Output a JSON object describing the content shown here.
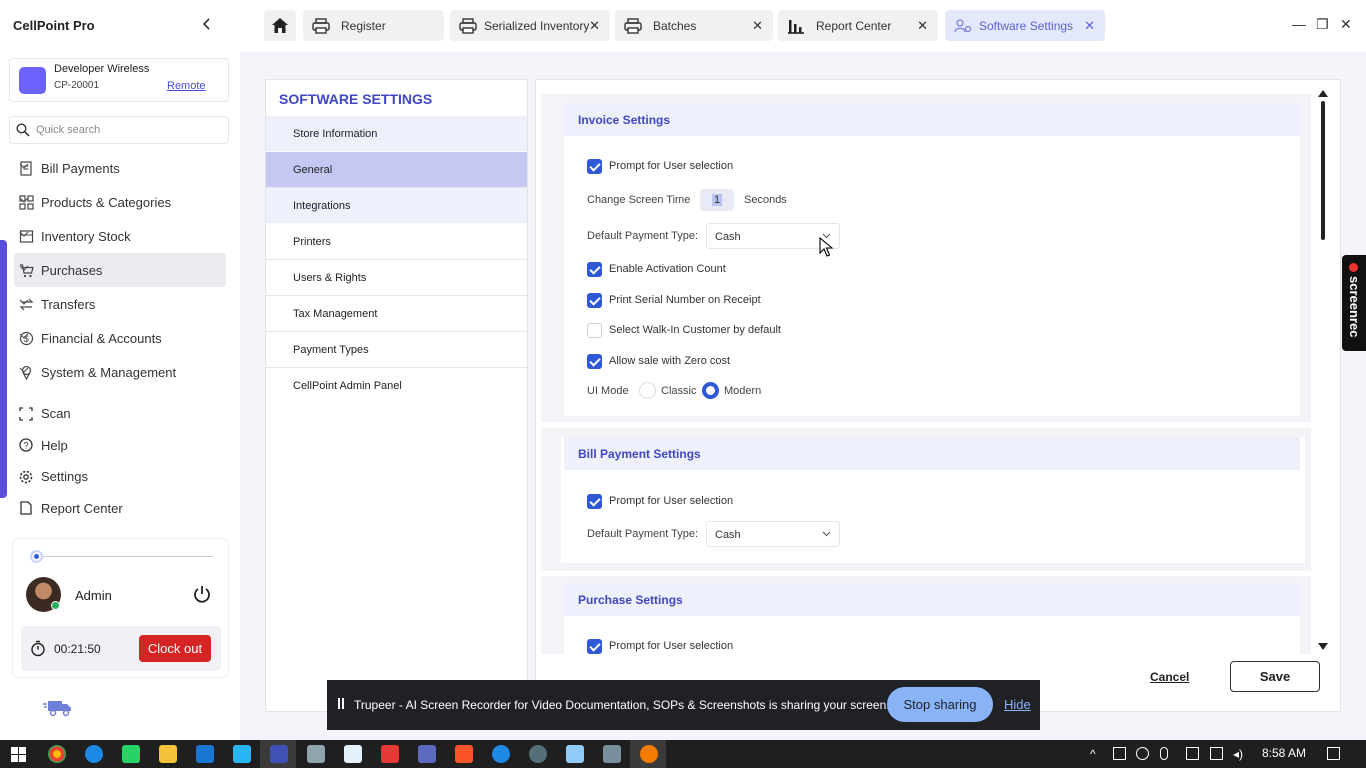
{
  "app": {
    "title": "CellPoint Pro"
  },
  "store": {
    "name": "Developer Wireless",
    "code": "CP-20001",
    "remote_label": "Remote"
  },
  "search": {
    "placeholder": "Quick search"
  },
  "sidebar": {
    "menu": [
      {
        "label": "Bill Payments",
        "icon": "receipt-icon"
      },
      {
        "label": "Products & Categories",
        "icon": "grid-icon"
      },
      {
        "label": "Inventory Stock",
        "icon": "box-icon"
      },
      {
        "label": "Purchases",
        "icon": "cart-icon"
      },
      {
        "label": "Transfers",
        "icon": "transfer-icon"
      },
      {
        "label": "Financial & Accounts",
        "icon": "dollar-icon"
      },
      {
        "label": "System & Management",
        "icon": "pin-icon"
      }
    ],
    "links": [
      {
        "label": "Scan",
        "icon": "scan-icon"
      },
      {
        "label": "Help",
        "icon": "help-icon"
      },
      {
        "label": "Settings",
        "icon": "gear-icon"
      },
      {
        "label": "Report Center",
        "icon": "document-icon"
      }
    ]
  },
  "user": {
    "name": "Admin",
    "timer": "00:21:50",
    "clock_out_label": "Clock out"
  },
  "tabs": [
    {
      "label": "Register",
      "icon": "printer-icon"
    },
    {
      "label": "Serialized Inventory",
      "icon": "printer-icon"
    },
    {
      "label": "Batches",
      "icon": "printer-icon"
    },
    {
      "label": "Report Center",
      "icon": "chart-icon"
    },
    {
      "label": "Software Settings",
      "icon": "users-gear-icon"
    }
  ],
  "settings_nav": {
    "title": "SOFTWARE SETTINGS",
    "items": [
      "Store Information",
      "General",
      "Integrations",
      "Printers",
      "Users & Rights",
      "Tax Management",
      "Payment Types",
      "CellPoint Admin Panel"
    ],
    "active": "General"
  },
  "invoice": {
    "title": "Invoice Settings",
    "prompt_user": "Prompt for User selection",
    "change_screen_time_label": "Change Screen Time",
    "change_screen_time_value": "1",
    "seconds_label": "Seconds",
    "default_payment_label": "Default Payment Type:",
    "default_payment_value": "Cash",
    "enable_activation": "Enable Activation Count",
    "print_serial": "Print Serial Number on Receipt",
    "walk_in": "Select Walk-In Customer by default",
    "zero_cost": "Allow sale with Zero cost",
    "ui_mode_label": "UI Mode",
    "ui_mode_classic": "Classic",
    "ui_mode_modern": "Modern"
  },
  "bill_payment": {
    "title": "Bill Payment Settings",
    "prompt_user": "Prompt for User selection",
    "default_payment_label": "Default Payment Type:",
    "default_payment_value": "Cash"
  },
  "purchase": {
    "title": "Purchase Settings",
    "prompt_user": "Prompt for User selection"
  },
  "actions": {
    "cancel": "Cancel",
    "save": "Save"
  },
  "screenrec": {
    "label": "screenrec"
  },
  "share_bar": {
    "text": "Trupeer - AI Screen Recorder for Video Documentation, SOPs & Screenshots is sharing your screen.",
    "stop_label": "Stop sharing",
    "hide_label": "Hide"
  },
  "taskbar": {
    "time": "8:58 AM"
  },
  "colors": {
    "accent": "#3f47c4",
    "checkbox": "#2f58d6",
    "danger": "#d62323",
    "active_nav": "#c6c8f4"
  }
}
